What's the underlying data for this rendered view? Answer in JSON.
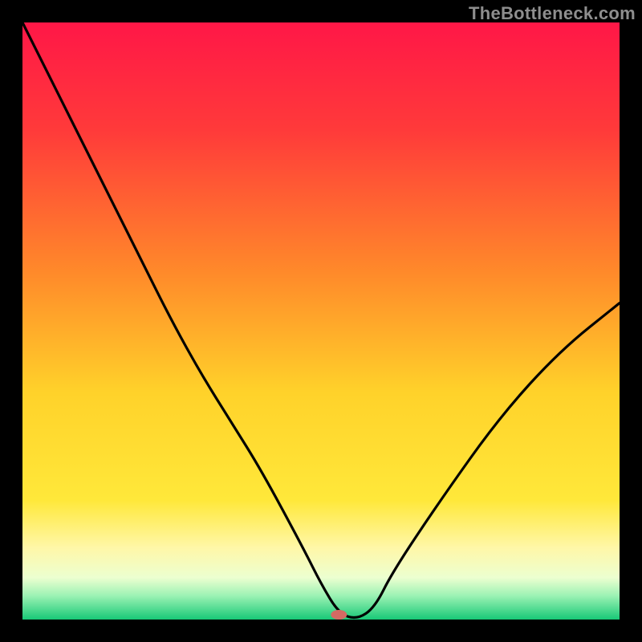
{
  "watermark": "TheBottleneck.com",
  "chart_data": {
    "type": "line",
    "title": "",
    "xlabel": "",
    "ylabel": "",
    "xlim": [
      0,
      100
    ],
    "ylim": [
      0,
      100
    ],
    "grid": false,
    "legend": false,
    "background_gradient_stops": [
      {
        "offset": 0,
        "color": "#ff1747"
      },
      {
        "offset": 18,
        "color": "#ff3a3a"
      },
      {
        "offset": 42,
        "color": "#ff8a2a"
      },
      {
        "offset": 62,
        "color": "#ffd22a"
      },
      {
        "offset": 80,
        "color": "#ffe83a"
      },
      {
        "offset": 88,
        "color": "#fff7a8"
      },
      {
        "offset": 93,
        "color": "#ecffd0"
      },
      {
        "offset": 96,
        "color": "#9cf2b4"
      },
      {
        "offset": 100,
        "color": "#18c977"
      }
    ],
    "series": [
      {
        "name": "bottleneck-curve",
        "x": [
          0,
          5,
          10,
          15,
          20,
          25,
          30,
          35,
          40,
          47,
          50,
          53,
          56,
          59,
          62,
          70,
          80,
          90,
          100
        ],
        "y": [
          100,
          90,
          80,
          70,
          60,
          50,
          41,
          33,
          25,
          12,
          6,
          1,
          0,
          2,
          8,
          20,
          34,
          45,
          53
        ]
      }
    ],
    "marker": {
      "x": 53,
      "y": 0.8,
      "color": "#d46a63",
      "rx": 10,
      "ry": 6
    }
  }
}
